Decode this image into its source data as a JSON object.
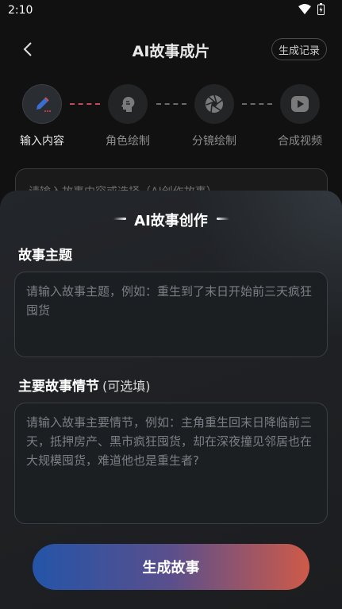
{
  "status_bar": {
    "time": "2:10"
  },
  "header": {
    "title": "AI故事成片",
    "history_label": "生成记录"
  },
  "steps": [
    {
      "label": "输入内容",
      "icon": "pencil-icon",
      "active": true
    },
    {
      "label": "角色绘制",
      "icon": "head-profile-icon",
      "active": false
    },
    {
      "label": "分镜绘制",
      "icon": "aperture-icon",
      "active": false
    },
    {
      "label": "合成视频",
      "icon": "play-icon",
      "active": false
    }
  ],
  "background_input": {
    "placeholder": "请输入故事内容或选择（AI创作故事）"
  },
  "sheet": {
    "title": "AI故事创作",
    "theme": {
      "label": "故事主题",
      "placeholder": "请输入故事主题，例如：重生到了末日开始前三天疯狂囤货"
    },
    "plot": {
      "label": "主要故事情节",
      "optional_label": "(可选填)",
      "placeholder": "请输入故事主要情节，例如：主角重生回末日降临前三天，抵押房产、黑市疯狂囤货，却在深夜撞见邻居也在大规模囤货，难道他也是重生者?"
    },
    "submit_label": "生成故事"
  },
  "colors": {
    "background": "#111111",
    "sheet": "#202226",
    "accent_dash": "#c14a55",
    "button_gradient_start": "#2454a8",
    "button_gradient_end": "#cf5a48"
  }
}
